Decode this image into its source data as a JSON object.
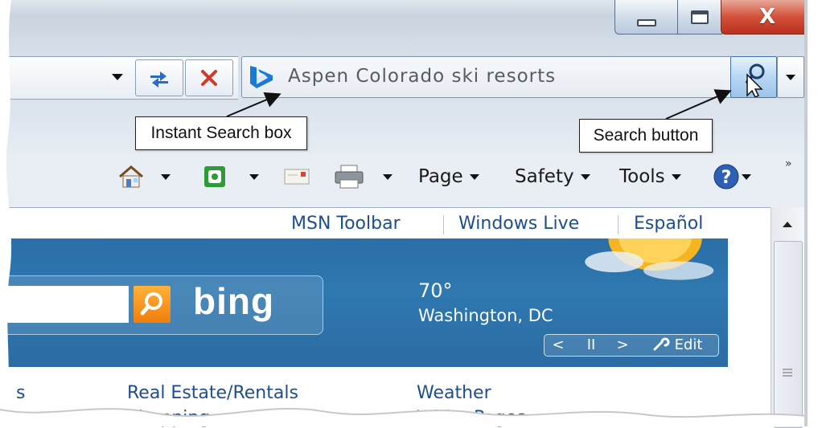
{
  "window": {
    "controls": {
      "minimize": "minimize-icon",
      "maximize": "maximize-icon",
      "close": "X"
    }
  },
  "address_bar": {
    "buttons": [
      "dropdown",
      "refresh-icon",
      "stop-icon"
    ]
  },
  "search": {
    "value": "Aspen Colorado ski resorts",
    "provider_icon": "bing-b-icon",
    "button_icon": "magnifier-icon"
  },
  "callouts": {
    "instant_search": "Instant Search box",
    "search_button": "Search button"
  },
  "command_bar": {
    "items": [
      {
        "icon": "home-icon"
      },
      {
        "icon": "feeds-icon"
      },
      {
        "icon": "mail-icon"
      },
      {
        "icon": "print-icon"
      },
      {
        "label": "Page"
      },
      {
        "label": "Safety"
      },
      {
        "label": "Tools"
      },
      {
        "icon": "help-icon"
      }
    ],
    "overflow": "»"
  },
  "page": {
    "top_links": [
      "MSN Toolbar",
      "Windows Live",
      "Español"
    ],
    "bing_logo": "bing",
    "weather": {
      "temp": "70°",
      "city": "Washington, DC"
    },
    "photo_controls": {
      "prev": "<",
      "pause": "II",
      "next": ">",
      "edit": "Edit"
    },
    "bottom_links": [
      "s",
      "Real Estate/Rentals",
      "Weather",
      "Shopping",
      "White Pages"
    ]
  },
  "colors": {
    "banner": "#2f78b0",
    "link": "#1d4e8f",
    "close_button": "#d4503a",
    "bing_orange": "#f39019"
  }
}
